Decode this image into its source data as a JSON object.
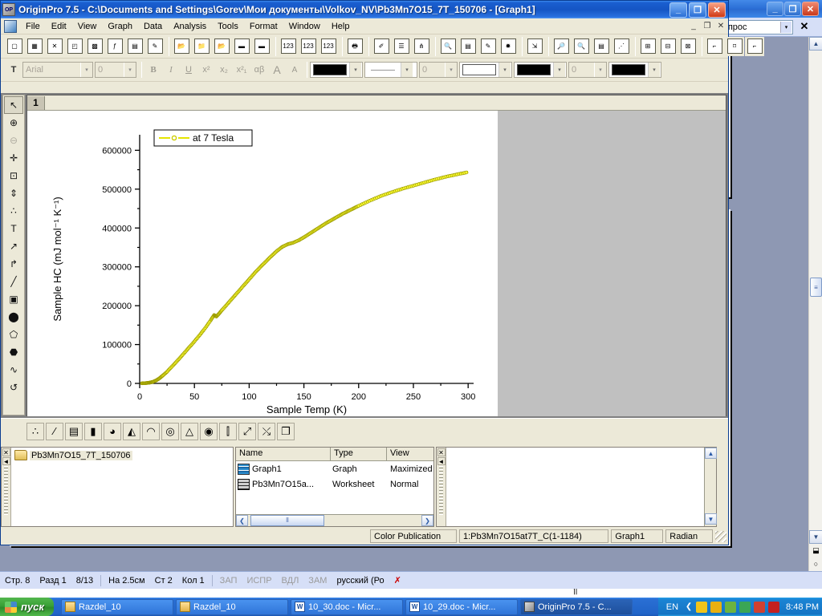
{
  "word": {
    "ask_box_value": "вопрос",
    "ask_arrow": "▾",
    "close_x": "✕",
    "min": "_",
    "restore": "❐",
    "close": "✕",
    "pilcrow": "¶",
    "statusbar": [
      {
        "label": "Стр. 8",
        "dim": false
      },
      {
        "label": "Разд 1",
        "dim": false
      },
      {
        "label": "8/13",
        "dim": false
      },
      {
        "label": "На 2.5см",
        "dim": false
      },
      {
        "label": "Ст 2",
        "dim": false
      },
      {
        "label": "Кол 1",
        "dim": false
      },
      {
        "label": "ЗАП",
        "dim": true
      },
      {
        "label": "ИСПР",
        "dim": true
      },
      {
        "label": "ВДЛ",
        "dim": true
      },
      {
        "label": "ЗАМ",
        "dim": true
      },
      {
        "label": "русский (Ро",
        "dim": false
      }
    ],
    "scroll": {
      "up": "▲",
      "down": "▼",
      "thumb": "≡",
      "split": "⬓",
      "select": "○"
    }
  },
  "origin": {
    "title": "OriginPro 7.5 - C:\\Documents and Settings\\Gorev\\Мои документы\\Volkov_NV\\Pb3Mn7O15_7T_150706 - [Graph1]",
    "title_icon": "OP",
    "window_buttons": {
      "minimize": "_",
      "restore": "❐",
      "close": "✕"
    },
    "mdi_buttons": {
      "minimize": "_",
      "restore": "❐",
      "close": "✕"
    },
    "menus": [
      "File",
      "Edit",
      "View",
      "Graph",
      "Data",
      "Analysis",
      "Tools",
      "Format",
      "Window",
      "Help"
    ],
    "standard_toolbar": [
      {
        "name": "new-project",
        "glyph": "▢"
      },
      {
        "name": "new-worksheet",
        "glyph": "▦"
      },
      {
        "name": "new-excel",
        "glyph": "✕"
      },
      {
        "name": "new-graph",
        "glyph": "◰"
      },
      {
        "name": "new-matrix",
        "glyph": "▩"
      },
      {
        "name": "new-function-plot",
        "glyph": "ƒ"
      },
      {
        "name": "new-layout",
        "glyph": "▤"
      },
      {
        "name": "new-notes",
        "glyph": "✎"
      },
      {
        "name": "open-project",
        "glyph": "📂"
      },
      {
        "name": "open-template",
        "glyph": "📁"
      },
      {
        "name": "open-excel",
        "glyph": "📂"
      },
      {
        "name": "save-project",
        "glyph": "▬"
      },
      {
        "name": "save-template",
        "glyph": "▬"
      },
      {
        "name": "import-ascii",
        "glyph": "123"
      },
      {
        "name": "import-multiple-ascii",
        "glyph": "123"
      },
      {
        "name": "import-wizard",
        "glyph": "123"
      },
      {
        "name": "print",
        "glyph": "🖶"
      },
      {
        "name": "add-text",
        "glyph": "✐"
      },
      {
        "name": "layer-management",
        "glyph": "☰"
      },
      {
        "name": "layer-contents",
        "glyph": "⋔"
      },
      {
        "name": "project-explorer",
        "glyph": "🔍"
      },
      {
        "name": "results-log",
        "glyph": "▤"
      },
      {
        "name": "script-window",
        "glyph": "✎"
      },
      {
        "name": "3d-rotate",
        "glyph": "✹"
      },
      {
        "name": "scale-in",
        "glyph": "⇲"
      },
      {
        "name": "zoom-in",
        "glyph": "🔎"
      },
      {
        "name": "zoom-out",
        "glyph": "🔍"
      },
      {
        "name": "data-display",
        "glyph": "▤"
      },
      {
        "name": "data-selector",
        "glyph": "⋰"
      },
      {
        "name": "merge-graph",
        "glyph": "⊞"
      },
      {
        "name": "arrange-layers-4",
        "glyph": "⊟"
      },
      {
        "name": "arrange-layers-6",
        "glyph": "⊠"
      },
      {
        "name": "add-bottom-left-axes",
        "glyph": "⌐"
      },
      {
        "name": "add-right-axis",
        "glyph": "⌑"
      },
      {
        "name": "add-top-axis",
        "glyph": "⌐"
      }
    ],
    "format_toolbar": {
      "font_icon": "T",
      "font_name": "Arial",
      "font_size": "0",
      "bold": "B",
      "italic": "I",
      "underline": "U",
      "superscript": "x²",
      "subscript": "x₂",
      "super_sub": "x²₁",
      "greek": "αβ",
      "increase_font": "A",
      "decrease_font": "A",
      "arrow": "▾",
      "line_color": "#000000",
      "line_style_preview": "———",
      "line_width": "0",
      "fill_pattern": "#ffffff",
      "fill_color": "#000000",
      "pattern_width": "0",
      "pattern_color": "#000000"
    },
    "tools_palette": [
      {
        "name": "pointer-tool",
        "glyph": "↖",
        "state": "pressed"
      },
      {
        "name": "zoom-in-tool",
        "glyph": "⊕",
        "state": "normal"
      },
      {
        "name": "zoom-out-tool",
        "glyph": "⊖",
        "state": "disabled"
      },
      {
        "name": "crosshair-tool",
        "glyph": "✛",
        "state": "normal"
      },
      {
        "name": "scale-tool",
        "glyph": "⊡",
        "state": "normal"
      },
      {
        "name": "data-reader-tool",
        "glyph": "⇕",
        "state": "normal"
      },
      {
        "name": "data-selector-tool",
        "glyph": "∴",
        "state": "normal"
      },
      {
        "name": "text-tool",
        "glyph": "T",
        "state": "normal"
      },
      {
        "name": "arrow-tool",
        "glyph": "↗",
        "state": "normal"
      },
      {
        "name": "curved-arrow-tool",
        "glyph": "↱",
        "state": "normal"
      },
      {
        "name": "line-tool",
        "glyph": "╱",
        "state": "normal"
      },
      {
        "name": "rectangle-tool",
        "glyph": "▣",
        "state": "normal"
      },
      {
        "name": "ellipse-tool",
        "glyph": "⬤",
        "state": "normal"
      },
      {
        "name": "polygon-tool",
        "glyph": "⬠",
        "state": "normal"
      },
      {
        "name": "region-tool",
        "glyph": "⬣",
        "state": "normal"
      },
      {
        "name": "freehand-tool",
        "glyph": "∿",
        "state": "normal"
      },
      {
        "name": "undo-tool",
        "glyph": "↺",
        "state": "normal"
      }
    ],
    "plot_toolbar": [
      {
        "name": "scatter-plot-button",
        "glyph": "∴"
      },
      {
        "name": "line-symbol-plot-button",
        "glyph": "⁄"
      },
      {
        "name": "bar-plot-button",
        "glyph": "▤"
      },
      {
        "name": "column-plot-button",
        "glyph": "▮"
      },
      {
        "name": "pie-chart-button",
        "glyph": "◕"
      },
      {
        "name": "area-plot-button",
        "glyph": "◭"
      },
      {
        "name": "fill-area-plot-button",
        "glyph": "◠"
      },
      {
        "name": "polar-plot-button",
        "glyph": "◎"
      },
      {
        "name": "ternary-plot-button",
        "glyph": "△"
      },
      {
        "name": "3d-surface-button",
        "glyph": "◉"
      },
      {
        "name": "vertical-drop-button",
        "glyph": "⫿"
      },
      {
        "name": "vector-plot-button",
        "glyph": "⤢"
      },
      {
        "name": "vector-xyam-button",
        "glyph": "⤯"
      },
      {
        "name": "template-library-button",
        "glyph": "❐"
      }
    ],
    "graph_window": {
      "tab_label": "1"
    },
    "project_explorer": {
      "folder_name": "Pb3Mn7O15_7T_150706",
      "columns": [
        "Name",
        "Type",
        "View"
      ],
      "rows": [
        {
          "name": "Graph1",
          "type": "Graph",
          "view": "Maximized",
          "icon": "graph"
        },
        {
          "name": "Pb3Mn7O15a...",
          "type": "Worksheet",
          "view": "Normal",
          "icon": "sheet"
        }
      ],
      "scroll_left": "❮",
      "scroll_right": "❯",
      "thumb": "⦀",
      "close_x": "✕",
      "collapse": "◄"
    },
    "statusbar": [
      "Color Publication",
      "1:Pb3Mn7O15at7T_C(1-1184)",
      "Graph1",
      "Radian"
    ]
  },
  "chart_data": {
    "type": "line",
    "title": "",
    "xlabel": "Sample Temp (K)",
    "ylabel": "Sample HC (mJ mol⁻¹ K⁻¹)",
    "legend": [
      {
        "label": "at 7 Tesla",
        "color": "#e5e500",
        "symbol": "open-circle"
      }
    ],
    "series_color": "#cccc00",
    "xlim": [
      0,
      305
    ],
    "ylim": [
      0,
      640000
    ],
    "xticks": [
      0,
      50,
      100,
      150,
      200,
      250,
      300
    ],
    "yticks": [
      0,
      100000,
      200000,
      300000,
      400000,
      500000,
      600000
    ],
    "minor_ticks": true,
    "grid": false,
    "legend_position": "top-left",
    "x": [
      2,
      5,
      8,
      10,
      12,
      15,
      18,
      21,
      25,
      30,
      35,
      40,
      45,
      50,
      55,
      60,
      65,
      68,
      70,
      72,
      75,
      80,
      85,
      90,
      95,
      100,
      105,
      110,
      115,
      120,
      125,
      130,
      135,
      140,
      145,
      150,
      155,
      160,
      165,
      170,
      175,
      180,
      185,
      190,
      195,
      200,
      210,
      220,
      230,
      240,
      250,
      260,
      270,
      280,
      290,
      300
    ],
    "y": [
      300,
      700,
      1500,
      2500,
      4000,
      7500,
      13000,
      20000,
      30000,
      45000,
      60000,
      76000,
      92000,
      108000,
      125000,
      143000,
      163000,
      176000,
      172000,
      178000,
      188000,
      204000,
      220000,
      236000,
      252000,
      268000,
      284000,
      299000,
      313000,
      327000,
      340000,
      351000,
      358000,
      362000,
      368000,
      376000,
      385000,
      394000,
      403000,
      412000,
      420000,
      428000,
      436000,
      443000,
      450000,
      457000,
      470000,
      482000,
      492000,
      501000,
      509000,
      517000,
      525000,
      532000,
      538000,
      544000
    ]
  },
  "taskbar": {
    "start_label": "пуск",
    "tasks": [
      {
        "label": "Razdel_10",
        "icon": "folder",
        "icon_text": "",
        "active": false
      },
      {
        "label": "Razdel_10",
        "icon": "folder",
        "icon_text": "",
        "active": false
      },
      {
        "label": "10_30.doc - Micr...",
        "icon": "word",
        "icon_text": "W",
        "active": false
      },
      {
        "label": "10_29.doc - Micr...",
        "icon": "word",
        "icon_text": "W",
        "active": false
      },
      {
        "label": "OriginPro 7.5 - C...",
        "icon": "origin",
        "icon_text": "",
        "active": true
      }
    ],
    "language": "EN",
    "chevron": "❮",
    "tray_icons": [
      {
        "name": "tray-icon-antivirus",
        "color": "#f0c419"
      },
      {
        "name": "tray-icon-warning",
        "color": "#e8b010"
      },
      {
        "name": "tray-icon-network",
        "color": "#6cb33f"
      },
      {
        "name": "tray-icon-updates",
        "color": "#3aa655"
      },
      {
        "name": "tray-icon-media",
        "color": "#d04030"
      },
      {
        "name": "tray-icon-security",
        "color": "#c42020"
      }
    ],
    "clock": "8:48 PM"
  }
}
